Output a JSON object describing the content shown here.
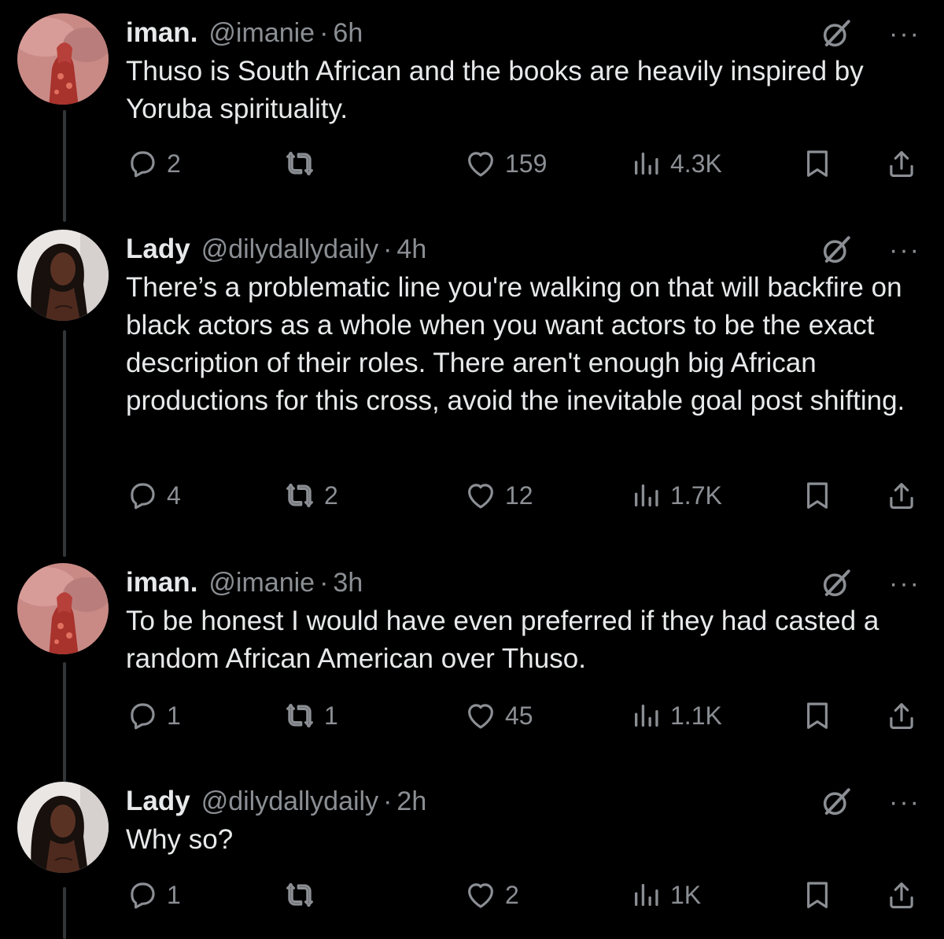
{
  "tweets": [
    {
      "display_name": "iman.",
      "handle": "@imanie",
      "time": "6h",
      "text": "Thuso is South African and the books are heavily inspired by Yoruba spirituality.",
      "replies": "2",
      "retweets": "",
      "likes": "159",
      "views": "4.3K",
      "avatar": "iman-avatar"
    },
    {
      "display_name": "Lady",
      "handle": "@dilydallydaily",
      "time": "4h",
      "text": "There’s a problematic line you're walking on that will backfire on black actors as a whole when you want actors to be the exact description of their roles. There aren't enough big African productions for this cross, avoid the inevitable goal post shifting.",
      "replies": "4",
      "retweets": "2",
      "likes": "12",
      "views": "1.7K",
      "avatar": "lady-avatar"
    },
    {
      "display_name": "iman.",
      "handle": "@imanie",
      "time": "3h",
      "text": "To be honest I would have even preferred if they had casted a random African American over Thuso.",
      "replies": "1",
      "retweets": "1",
      "likes": "45",
      "views": "1.1K",
      "avatar": "iman-avatar"
    },
    {
      "display_name": "Lady",
      "handle": "@dilydallydaily",
      "time": "2h",
      "text": "Why so?",
      "replies": "1",
      "retweets": "",
      "likes": "2",
      "views": "1K",
      "avatar": "lady-avatar"
    }
  ],
  "separator": "·",
  "more_glyph": "···",
  "icons": {
    "reply": "reply-icon",
    "retweet": "retweet-icon",
    "like": "heart-icon",
    "views": "views-icon",
    "bookmark": "bookmark-icon",
    "share": "share-icon",
    "grok": "grok-icon",
    "more": "more-icon"
  },
  "colors": {
    "background": "#000000",
    "text": "#e7e9ea",
    "muted": "#8b8f94",
    "thread_line": "#333639"
  }
}
